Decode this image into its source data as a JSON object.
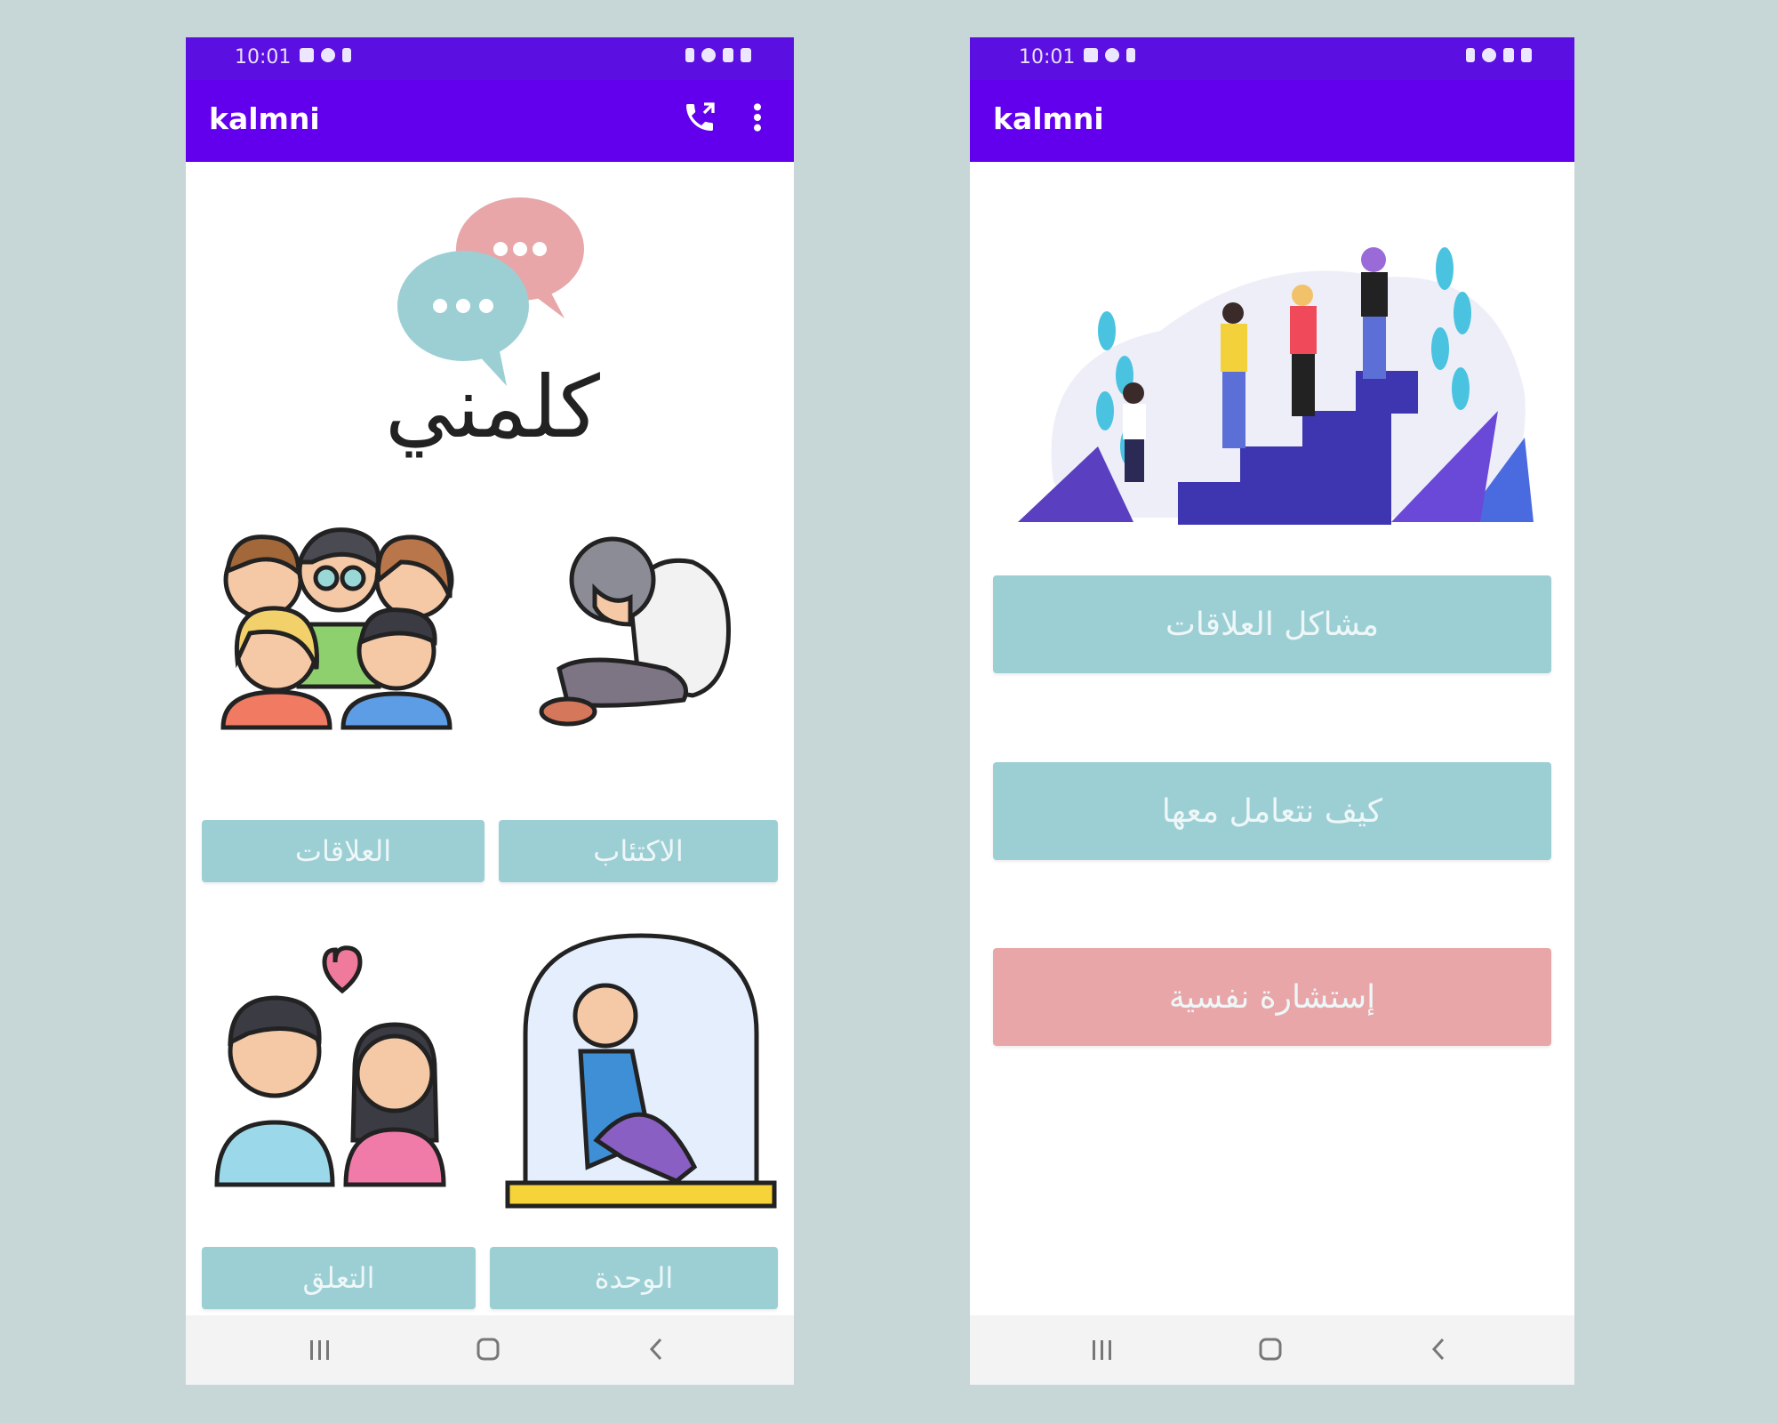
{
  "status_bar": {
    "time": "10:01"
  },
  "left_screen": {
    "app_title": "kalmni",
    "logo_text": "كلمني",
    "buttons": {
      "relationships": "العلاقات",
      "depression": "الاكتئاب",
      "attachment": "التعلق",
      "loneliness": "الوحدة"
    }
  },
  "right_screen": {
    "app_title": "kalmni",
    "buttons": {
      "relationship_problems": "مشاكل العلاقات",
      "how_to_deal": "كيف نتعامل معها",
      "consultation": "إستشارة نفسية"
    }
  },
  "colors": {
    "toolbar": "#6200ee",
    "status_bar": "#5b0fe0",
    "button_teal": "#9ccfd4",
    "button_pink": "#e8a6a8",
    "background": "#c7d6d7"
  },
  "icons": [
    "phone-call-icon",
    "more-vert-icon",
    "recents-icon",
    "home-icon",
    "back-icon"
  ]
}
